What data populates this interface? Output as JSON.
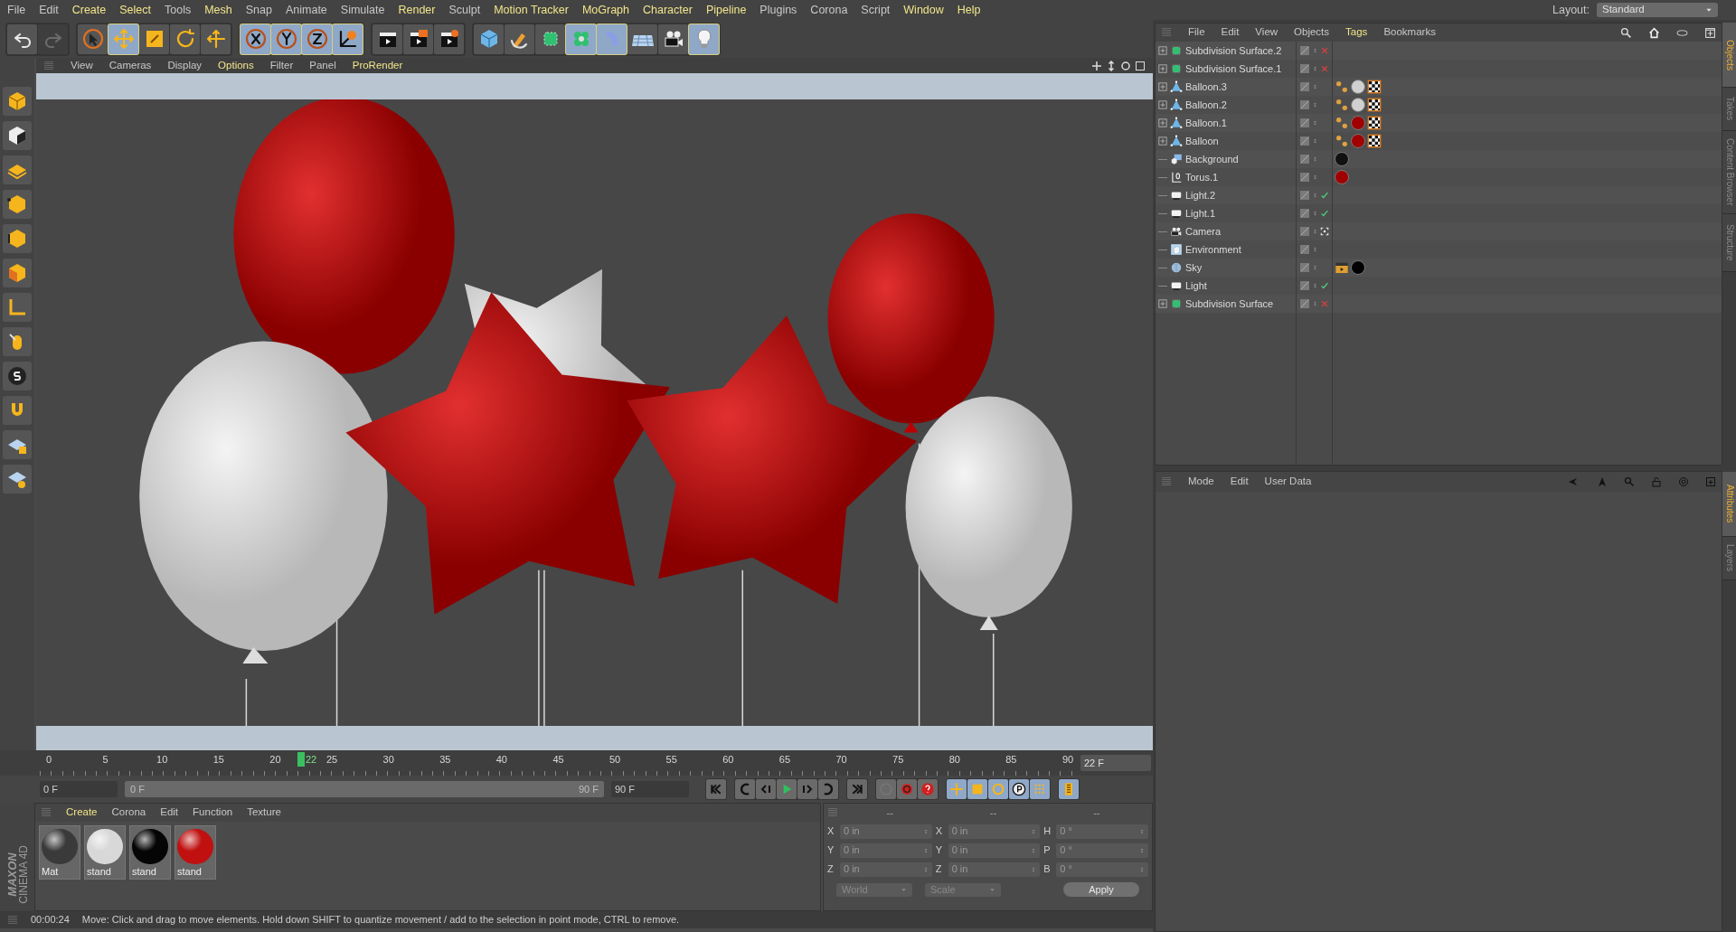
{
  "menu_bar": [
    {
      "label": "File",
      "highlighted": false
    },
    {
      "label": "Edit",
      "highlighted": false
    },
    {
      "label": "Create",
      "highlighted": true
    },
    {
      "label": "Select",
      "highlighted": true
    },
    {
      "label": "Tools",
      "highlighted": false
    },
    {
      "label": "Mesh",
      "highlighted": true
    },
    {
      "label": "Snap",
      "highlighted": false
    },
    {
      "label": "Animate",
      "highlighted": false
    },
    {
      "label": "Simulate",
      "highlighted": false
    },
    {
      "label": "Render",
      "highlighted": true
    },
    {
      "label": "Sculpt",
      "highlighted": false
    },
    {
      "label": "Motion Tracker",
      "highlighted": true
    },
    {
      "label": "MoGraph",
      "highlighted": true
    },
    {
      "label": "Character",
      "highlighted": true
    },
    {
      "label": "Pipeline",
      "highlighted": true
    },
    {
      "label": "Plugins",
      "highlighted": false
    },
    {
      "label": "Corona",
      "highlighted": false
    },
    {
      "label": "Script",
      "highlighted": false
    },
    {
      "label": "Window",
      "highlighted": true
    },
    {
      "label": "Help",
      "highlighted": true
    }
  ],
  "layout": {
    "label": "Layout:",
    "value": "Standard"
  },
  "toolbar": [
    {
      "kind": "undo",
      "selected": false,
      "disabled": false
    },
    {
      "kind": "redo",
      "selected": false,
      "disabled": true
    },
    {
      "kind": "live-select",
      "selected": false,
      "disabled": false
    },
    {
      "kind": "move",
      "selected": true,
      "disabled": false
    },
    {
      "kind": "scale",
      "selected": false,
      "disabled": false
    },
    {
      "kind": "rotate",
      "selected": false,
      "disabled": false
    },
    {
      "kind": "recent",
      "selected": false,
      "disabled": false
    },
    {
      "kind": "x-axis",
      "selected": true,
      "disabled": false
    },
    {
      "kind": "y-axis",
      "selected": true,
      "disabled": false
    },
    {
      "kind": "z-axis",
      "selected": true,
      "disabled": false
    },
    {
      "kind": "world",
      "selected": true,
      "disabled": false
    },
    {
      "kind": "render-view",
      "selected": false,
      "disabled": false
    },
    {
      "kind": "render-picture",
      "selected": false,
      "disabled": false
    },
    {
      "kind": "render-settings",
      "selected": false,
      "disabled": false
    },
    {
      "kind": "cube",
      "selected": false,
      "disabled": false
    },
    {
      "kind": "pen",
      "selected": false,
      "disabled": false
    },
    {
      "kind": "subdivision",
      "selected": false,
      "disabled": false
    },
    {
      "kind": "cloner",
      "selected": true,
      "disabled": false
    },
    {
      "kind": "deformer",
      "selected": true,
      "disabled": false
    },
    {
      "kind": "floor",
      "selected": false,
      "disabled": false
    },
    {
      "kind": "camera",
      "selected": false,
      "disabled": false
    },
    {
      "kind": "light",
      "selected": true,
      "disabled": false
    }
  ],
  "viewport": {
    "menu": [
      {
        "label": "View",
        "highlighted": false
      },
      {
        "label": "Cameras",
        "highlighted": false
      },
      {
        "label": "Display",
        "highlighted": false
      },
      {
        "label": "Options",
        "highlighted": true
      },
      {
        "label": "Filter",
        "highlighted": false
      },
      {
        "label": "Panel",
        "highlighted": false
      },
      {
        "label": "ProRender",
        "highlighted": true
      }
    ]
  },
  "timeline": {
    "ticks": [
      "0",
      "5",
      "10",
      "15",
      "20",
      "25",
      "30",
      "35",
      "40",
      "45",
      "50",
      "55",
      "60",
      "65",
      "70",
      "75",
      "80",
      "85",
      "90"
    ],
    "current": "22",
    "level": 0.244,
    "frame_field": "22 F"
  },
  "transport": {
    "start_field": "0 F",
    "range_start": "0 F",
    "range_end": "90 F",
    "level": 1,
    "end_field": "90 F"
  },
  "material_manager": {
    "menu": [
      {
        "label": "Create",
        "highlighted": true
      },
      {
        "label": "Corona",
        "highlighted": false
      },
      {
        "label": "Edit",
        "highlighted": false
      },
      {
        "label": "Function",
        "highlighted": false
      },
      {
        "label": "Texture",
        "highlighted": false
      }
    ],
    "materials": [
      {
        "name": "Mat",
        "color": "#3a3a3a"
      },
      {
        "name": "stand",
        "color": "#d8d8d8"
      },
      {
        "name": "stand",
        "color": "#050505"
      },
      {
        "name": "stand",
        "color": "#c01010"
      }
    ]
  },
  "logo": {
    "line_1": "MAXON",
    "line_2": "CINEMA 4D"
  },
  "coordinates": {
    "headers": [
      "--",
      "--",
      "--"
    ],
    "rows": [
      {
        "label_1": "X",
        "value_1": "0 in",
        "label_2": "X",
        "value_2": "0 in",
        "label_3": "H",
        "value_3": "0 °"
      },
      {
        "label_1": "Y",
        "value_1": "0 in",
        "label_2": "Y",
        "value_2": "0 in",
        "label_3": "P",
        "value_3": "0 °"
      },
      {
        "label_1": "Z",
        "value_1": "0 in",
        "label_2": "Z",
        "value_2": "0 in",
        "label_3": "B",
        "value_3": "0 °"
      }
    ],
    "dropdown_1": "World",
    "dropdown_2": "Scale",
    "button": "Apply"
  },
  "status_bar": {
    "time": "00:00:24",
    "message": "Move: Click and drag to move elements. Hold down SHIFT to quantize movement / add to the selection in point mode, CTRL to remove."
  },
  "object_manager": {
    "menu": [
      {
        "label": "File",
        "highlighted": false
      },
      {
        "label": "Edit",
        "highlighted": false
      },
      {
        "label": "View",
        "highlighted": false
      },
      {
        "label": "Objects",
        "highlighted": false
      },
      {
        "label": "Tags",
        "highlighted": true
      },
      {
        "label": "Bookmarks",
        "highlighted": false
      }
    ],
    "objects": [
      {
        "name": "Subdivision Surface.2",
        "kind": "subdivision",
        "expandable": true,
        "enabled": false
      },
      {
        "name": "Subdivision Surface.1",
        "kind": "subdivision",
        "expandable": true,
        "enabled": false
      },
      {
        "name": "Balloon.3",
        "kind": "polygon",
        "expandable": true,
        "tags": [
          {
            "kind": "phong"
          },
          {
            "kind": "material",
            "color": "#d0d0d0"
          },
          {
            "kind": "uvw"
          }
        ]
      },
      {
        "name": "Balloon.2",
        "kind": "polygon",
        "expandable": true,
        "tags": [
          {
            "kind": "phong"
          },
          {
            "kind": "material",
            "color": "#d0d0d0"
          },
          {
            "kind": "uvw"
          }
        ]
      },
      {
        "name": "Balloon.1",
        "kind": "polygon",
        "expandable": true,
        "tags": [
          {
            "kind": "phong"
          },
          {
            "kind": "material",
            "color": "#a00000"
          },
          {
            "kind": "uvw"
          }
        ]
      },
      {
        "name": "Balloon",
        "kind": "polygon",
        "expandable": true,
        "tags": [
          {
            "kind": "phong"
          },
          {
            "kind": "material",
            "color": "#a00000"
          },
          {
            "kind": "uvw"
          }
        ]
      },
      {
        "name": "Background",
        "kind": "background",
        "expandable": false,
        "tags": [
          {
            "kind": "material",
            "color": "#111111"
          }
        ]
      },
      {
        "name": "Torus.1",
        "kind": "torus",
        "expandable": false,
        "tags": [
          {
            "kind": "material",
            "color": "#a00000"
          }
        ]
      },
      {
        "name": "Light.2",
        "kind": "light",
        "expandable": false,
        "enabled": true
      },
      {
        "name": "Light.1",
        "kind": "light",
        "expandable": false,
        "enabled": true
      },
      {
        "name": "Camera",
        "kind": "camera",
        "expandable": false,
        "active": true
      },
      {
        "name": "Environment",
        "kind": "environment",
        "expandable": false
      },
      {
        "name": "Sky",
        "kind": "sky",
        "expandable": false,
        "tags": [
          {
            "kind": "render"
          },
          {
            "kind": "material",
            "color": "#000000"
          }
        ]
      },
      {
        "name": "Light",
        "kind": "light",
        "expandable": false,
        "enabled": true
      },
      {
        "name": "Subdivision Surface",
        "kind": "subdivision",
        "expandable": true,
        "enabled": false
      }
    ]
  },
  "attribute_manager": {
    "menu": [
      "Mode",
      "Edit",
      "User Data"
    ]
  },
  "side_tabs": [
    {
      "label": "Objects",
      "selected": true
    },
    {
      "label": "Takes",
      "selected": false
    },
    {
      "label": "Content Browser",
      "selected": false
    },
    {
      "label": "Structure",
      "selected": false
    },
    {
      "label": "Attributes",
      "selected": true
    },
    {
      "label": "Layers",
      "selected": false
    }
  ]
}
